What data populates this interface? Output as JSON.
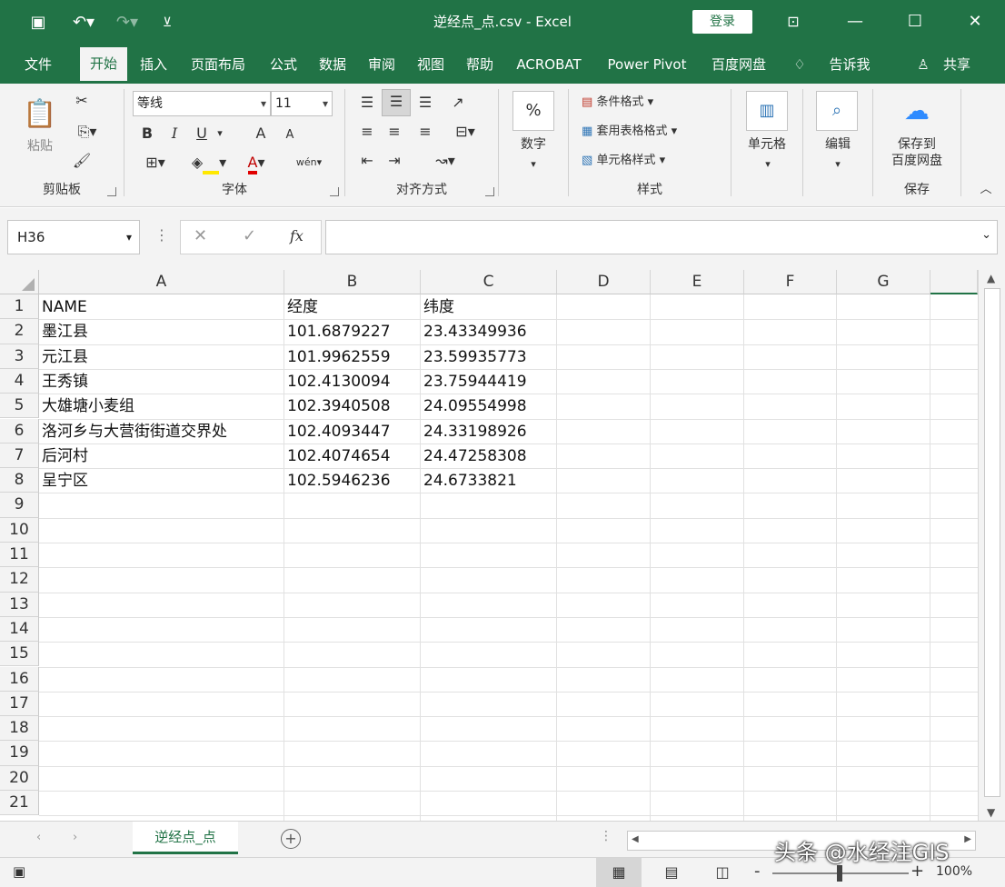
{
  "window": {
    "title": "逆经点_点.csv  -  Excel",
    "login_label": "登录"
  },
  "tabs": [
    "文件",
    "开始",
    "插入",
    "页面布局",
    "公式",
    "数据",
    "审阅",
    "视图",
    "帮助",
    "ACROBAT",
    "Power Pivot",
    "百度网盘",
    "告诉我",
    "共享"
  ],
  "ribbon": {
    "clipboard": {
      "paste": "粘贴",
      "label": "剪贴板"
    },
    "font": {
      "name": "等线",
      "size": "11",
      "bold": "B",
      "italic": "I",
      "underline": "U",
      "grow": "A",
      "shrink": "A",
      "font_color": "A",
      "phonetic": "wén",
      "label": "字体"
    },
    "alignment": {
      "label": "对齐方式"
    },
    "number": {
      "symbol": "%",
      "label": "数字"
    },
    "styles": {
      "conditional": "条件格式",
      "table": "套用表格格式",
      "cell_styles": "单元格样式",
      "label": "样式"
    },
    "cells": {
      "label": "单元格"
    },
    "editing": {
      "label": "编辑"
    },
    "save": {
      "line1": "保存到",
      "line2": "百度网盘",
      "label": "保存"
    }
  },
  "formula_bar": {
    "name_box": "H36",
    "cancel": "✕",
    "enter": "✓",
    "fx": "fx",
    "value": ""
  },
  "grid": {
    "columns": [
      "A",
      "B",
      "C",
      "D",
      "E",
      "F",
      "G"
    ],
    "rows": [
      "1",
      "2",
      "3",
      "4",
      "5",
      "6",
      "7",
      "8",
      "9",
      "10",
      "11",
      "12",
      "13",
      "14",
      "15",
      "16",
      "17",
      "18",
      "19",
      "20",
      "21"
    ],
    "cells": [
      [
        "NAME",
        "经度",
        "纬度"
      ],
      [
        "墨江县",
        "101.6879227",
        "23.43349936"
      ],
      [
        "元江县",
        "101.9962559",
        "23.59935773"
      ],
      [
        "王秀镇",
        "102.4130094",
        "23.75944419"
      ],
      [
        "大雄塘小麦组",
        "102.3940508",
        "24.09554998"
      ],
      [
        "洛河乡与大营街街道交界处",
        "102.4093447",
        "24.33198926"
      ],
      [
        "后河村",
        "102.4074654",
        "24.47258308"
      ],
      [
        "呈宁区",
        "102.5946236",
        "24.6733821"
      ]
    ]
  },
  "sheets": {
    "active": "逆经点_点",
    "add": "+"
  },
  "status": {
    "zoom": "100%",
    "minus": "-",
    "plus": "+"
  },
  "watermark": "头条 @水经注GIS"
}
